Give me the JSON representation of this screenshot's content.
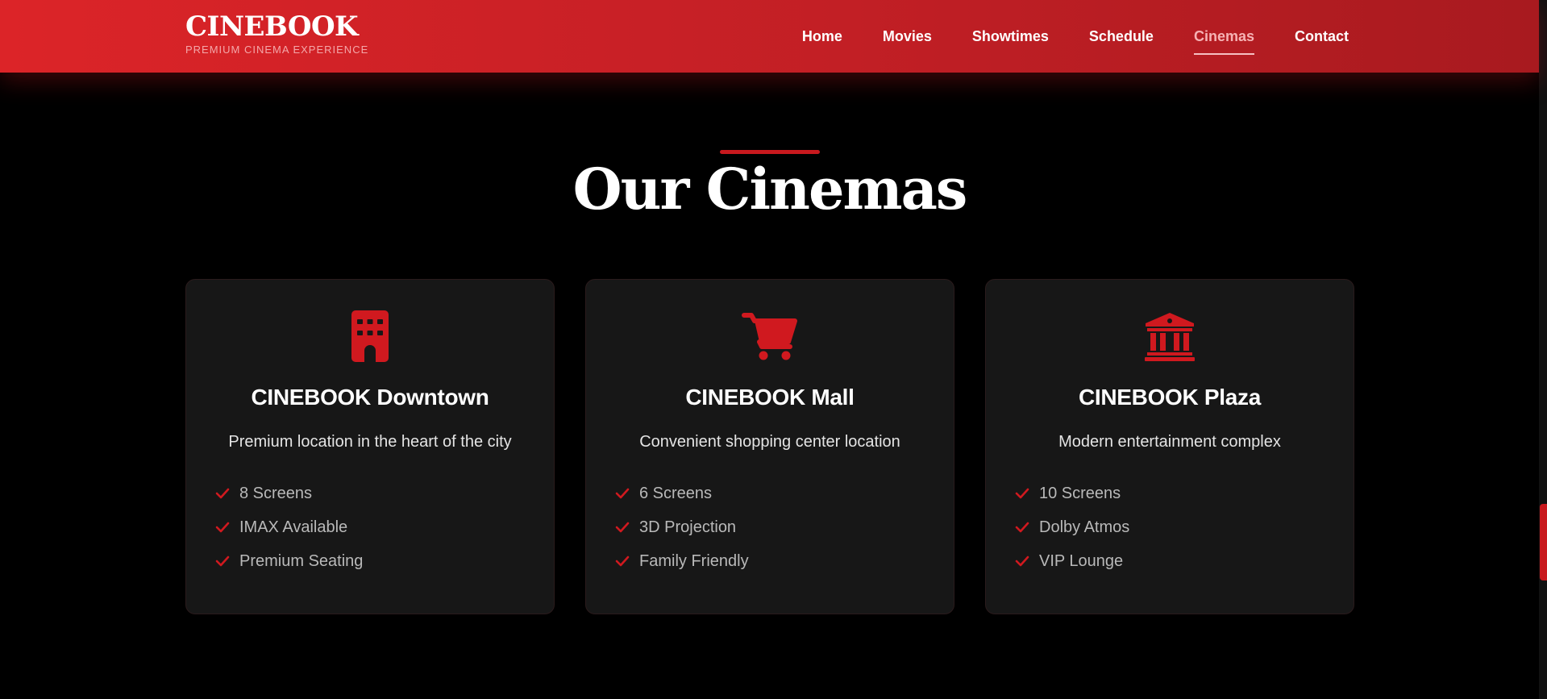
{
  "brand": {
    "title": "CINEBOOK",
    "tagline": "PREMIUM CINEMA EXPERIENCE"
  },
  "nav": {
    "items": [
      {
        "label": "Home"
      },
      {
        "label": "Movies"
      },
      {
        "label": "Showtimes"
      },
      {
        "label": "Schedule"
      },
      {
        "label": "Cinemas",
        "active": true
      },
      {
        "label": "Contact"
      }
    ]
  },
  "section": {
    "title": "Our Cinemas"
  },
  "cinemas": [
    {
      "icon": "building-icon",
      "name": "CINEBOOK Downtown",
      "description": "Premium location in the heart of the city",
      "features": [
        "8 Screens",
        "IMAX Available",
        "Premium Seating"
      ]
    },
    {
      "icon": "shopping-cart-icon",
      "name": "CINEBOOK Mall",
      "description": "Convenient shopping center location",
      "features": [
        "6 Screens",
        "3D Projection",
        "Family Friendly"
      ]
    },
    {
      "icon": "landmark-icon",
      "name": "CINEBOOK Plaza",
      "description": "Modern entertainment complex",
      "features": [
        "10 Screens",
        "Dolby Atmos",
        "VIP Lounge"
      ]
    }
  ],
  "colors": {
    "accent": "#c8191e",
    "header_start": "#dc2428",
    "header_end": "#a81a1f",
    "card_bg": "#171717",
    "active_nav": "#f6b2b4"
  }
}
